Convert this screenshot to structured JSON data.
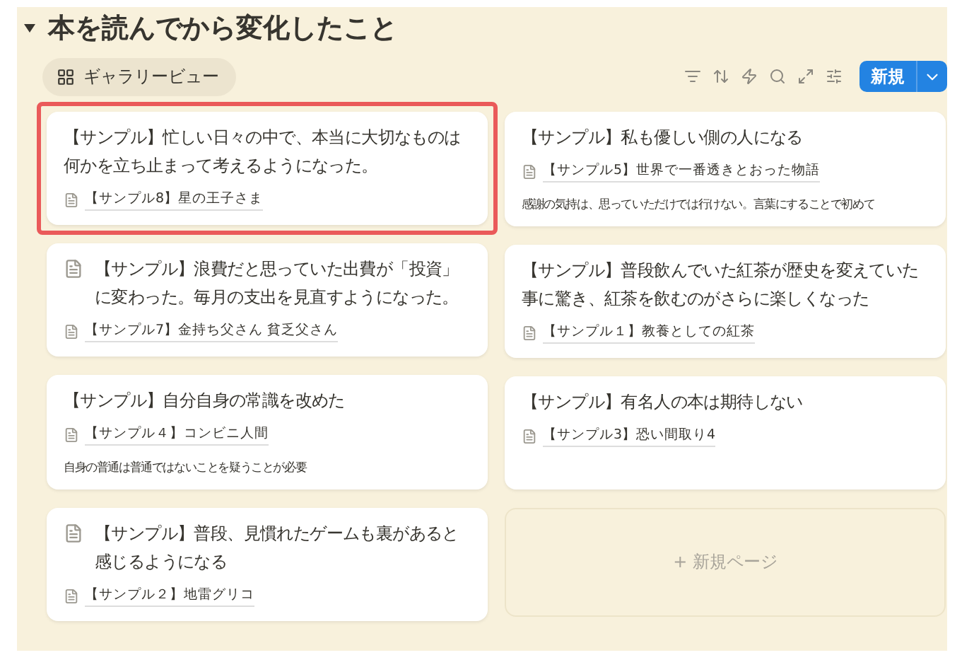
{
  "section": {
    "title": "本を読んでから変化したこと",
    "expanded": true
  },
  "view_tab": {
    "label": "ギャラリービュー"
  },
  "new_button": {
    "label": "新規"
  },
  "cards": [
    {
      "title": "【サンプル】忙しい日々の中で、本当に大切なものは何かを立ち止まって考えるようになった。",
      "page_icon": false,
      "relation": "【サンプル8】星の王子さま",
      "highlighted": true
    },
    {
      "title": "【サンプル】私も優しい側の人になる",
      "page_icon": false,
      "relation": "【サンプル5】世界で一番透きとおった物語",
      "note": "感謝の気持は、思っていただけでは行けない。言葉にすることで初めて",
      "highlighted": false
    },
    {
      "title": "【サンプル】浪費だと思っていた出費が「投資」に変わった。毎月の支出を見直すようになった。",
      "page_icon": true,
      "relation": "【サンプル7】金持ち父さん 貧乏父さん",
      "highlighted": false
    },
    {
      "title": "【サンプル】普段飲んでいた紅茶が歴史を変えていた事に驚き、紅茶を飲むのがさらに楽しくなった",
      "page_icon": false,
      "relation": "【サンプル１】教養としての紅茶",
      "highlighted": false
    },
    {
      "title": "【サンプル】自分自身の常識を改めた",
      "page_icon": false,
      "relation": "【サンプル４】コンビニ人間",
      "note": "自身の普通は普通ではないことを疑うことが必要",
      "highlighted": false
    },
    {
      "title": "【サンプル】有名人の本は期待しない",
      "page_icon": false,
      "relation": "【サンプル3】恐い間取り4",
      "highlighted": false
    },
    {
      "title": "【サンプル】普段、見慣れたゲームも裏があると感じるようになる",
      "page_icon": true,
      "relation": "【サンプル２】地雷グリコ",
      "highlighted": false
    }
  ],
  "new_page": {
    "label": "+ 新規ページ"
  }
}
